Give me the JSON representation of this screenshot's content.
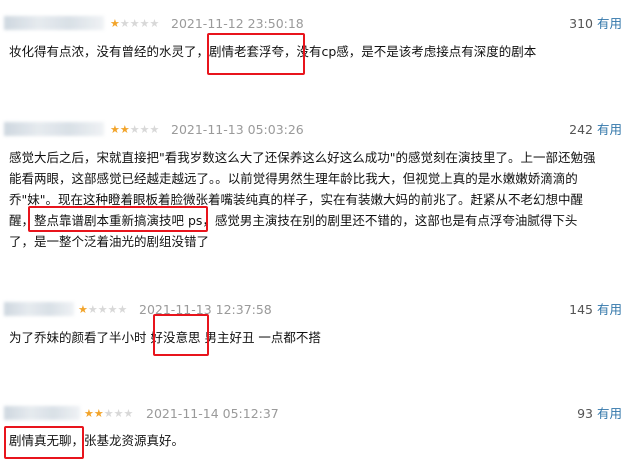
{
  "reviews": [
    {
      "stars": 1,
      "date": "2021-11-12 23:50:18",
      "votes": "310",
      "useful": "有用",
      "lines": [
        "妆化得有点浓，没有曾经的水灵了，剧情老套浮夸，没有cp感，是不是该考虑接点有深度的剧本"
      ]
    },
    {
      "stars": 2,
      "date": "2021-11-13 05:03:26",
      "votes": "242",
      "useful": "有用",
      "lines": [
        "感觉大后之后，宋就直接把\"看我岁数这么大了还保养这么好这么成功\"的感觉刻在演技里了。上一部还勉强",
        "能看两眼，这部感觉已经越走越远了。。以前觉得男然生理年龄比我大，但视觉上真的是水嫩嫩娇滴滴的",
        "乔\"妹\"。现在这种瞪着眼板着脸微张着嘴装纯真的样子，实在有装嫩大妈的前兆了。赶紧从不老幻想中醒",
        "醒，整点靠谱剧本重新搞演技吧 ps，感觉男主演技在别的剧里还不错的，这部也是有点浮夸油腻得下头",
        "了，是一整个泛着油光的剧组没错了"
      ]
    },
    {
      "stars": 1,
      "date": "2021-11-13 12:37:58",
      "votes": "145",
      "useful": "有用",
      "lines": [
        "为了乔妹的颜看了半小时 好没意思 男主好丑 一点都不搭"
      ]
    },
    {
      "stars": 2,
      "date": "2021-11-14 05:12:37",
      "votes": "93",
      "useful": "有用",
      "lines": [
        "剧情真无聊，张基龙资源真好。"
      ]
    }
  ],
  "colors": {
    "star_on": "#f2a42a",
    "star_off": "#d8d8d8",
    "highlight_box": "#e8141c",
    "useful_link": "#3377aa"
  },
  "icons": {
    "star": "star-icon",
    "avatar": "blurred-avatar"
  }
}
